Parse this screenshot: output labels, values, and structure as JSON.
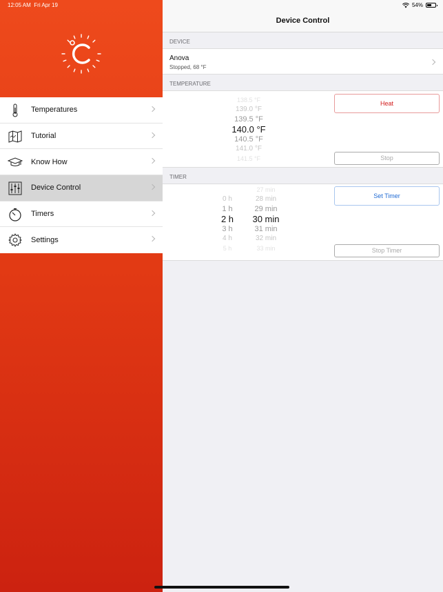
{
  "status": {
    "time": "12:05 AM",
    "date": "Fri Apr 19",
    "battery": "54%"
  },
  "sidebar": {
    "items": [
      {
        "label": "Temperatures",
        "icon": "thermometer-icon",
        "active": false
      },
      {
        "label": "Tutorial",
        "icon": "map-icon",
        "active": false
      },
      {
        "label": "Know How",
        "icon": "graduation-cap-icon",
        "active": false
      },
      {
        "label": "Device Control",
        "icon": "sliders-icon",
        "active": true
      },
      {
        "label": "Timers",
        "icon": "stopwatch-icon",
        "active": false
      },
      {
        "label": "Settings",
        "icon": "gear-icon",
        "active": false
      }
    ]
  },
  "nav": {
    "title": "Device Control"
  },
  "device": {
    "header": "DEVICE",
    "name": "Anova",
    "status": "Stopped, 68 °F"
  },
  "temperature": {
    "header": "TEMPERATURE",
    "values": [
      "138.5 °F",
      "139.0 °F",
      "139.5 °F",
      "140.0 °F",
      "140.5 °F",
      "141.0 °F",
      "141.5 °F"
    ],
    "selected_index": 3,
    "heat_label": "Heat",
    "stop_label": "Stop"
  },
  "timer": {
    "header": "TIMER",
    "hours": [
      "",
      "",
      "0 h",
      "1 h",
      "2 h",
      "3 h",
      "4 h",
      "5 h"
    ],
    "minutes": [
      "27 min",
      "28 min",
      "29 min",
      "30 min",
      "31 min",
      "32 min",
      "33 min"
    ],
    "selected_hour_index": 4,
    "selected_minute_index": 3,
    "set_label": "Set Timer",
    "stop_label": "Stop Timer"
  },
  "colors": {
    "brand": "#e8441a",
    "heat": "#d21a1a",
    "timer_blue": "#1f6ad3"
  }
}
